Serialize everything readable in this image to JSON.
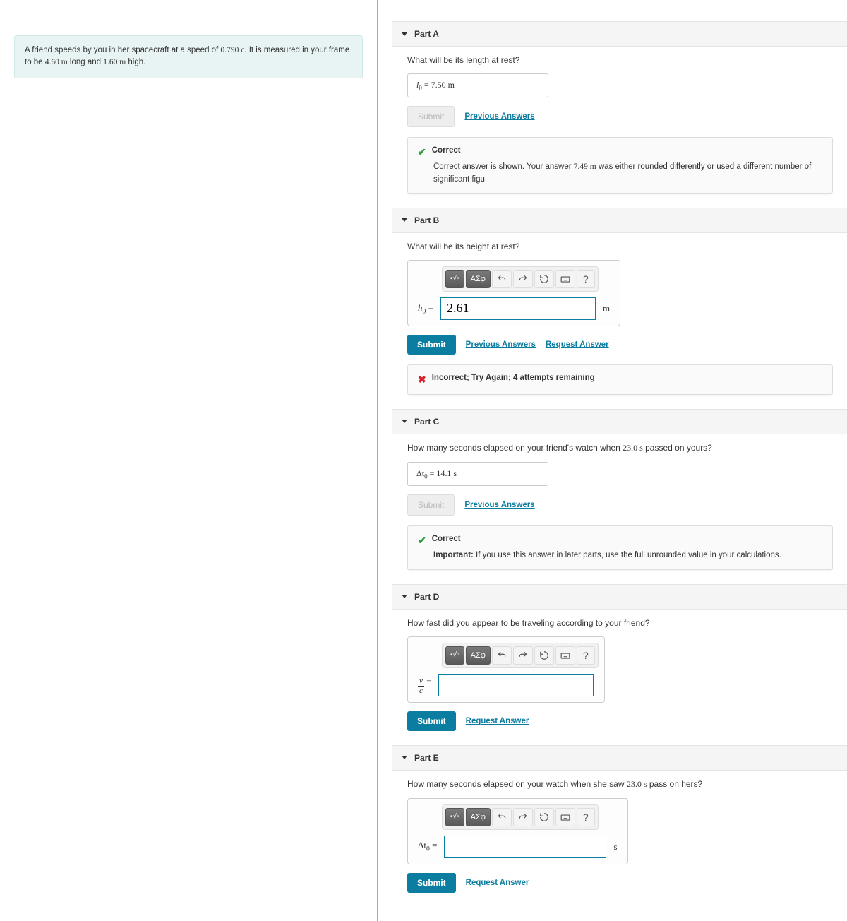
{
  "problem": {
    "text_before_speed": "A friend speeds by you in her spacecraft at a speed of ",
    "speed": "0.790 c",
    "text_mid": ". It is measured in your frame to be ",
    "length": "4.60 m",
    "text_mid2": " long and ",
    "height": "1.60 m",
    "text_after": " high."
  },
  "links": {
    "submit": "Submit",
    "previous_answers": "Previous Answers",
    "request_answer": "Request Answer"
  },
  "partA": {
    "title": "Part A",
    "question": "What will be its length at rest?",
    "var": "l",
    "sub": "0",
    "eq": " = ",
    "value": "7.50 ",
    "unit": "m",
    "fb_title": "Correct",
    "fb_body_pre": "Correct answer is shown. Your answer ",
    "fb_ans": "7.49 m",
    "fb_body_post": " was either rounded differently or used a different number of significant figu"
  },
  "partB": {
    "title": "Part B",
    "question": "What will be its height at rest?",
    "var": "h",
    "sub": "0",
    "eq": " = ",
    "value": "2.61",
    "unit": "m",
    "fb_title": "Incorrect; Try Again; 4 attempts remaining"
  },
  "partC": {
    "title": "Part C",
    "q_pre": "How many seconds elapsed on your friend's watch when ",
    "q_val": "23.0 s",
    "q_post": " passed on yours?",
    "var": "Δt",
    "sub": "0",
    "eq": " = ",
    "value": "14.1 ",
    "unit": "s",
    "fb_title": "Correct",
    "fb_important": "Important:",
    "fb_body": " If you use this answer in later parts, use the full unrounded value in your calculations."
  },
  "partD": {
    "title": "Part D",
    "question": "How fast did you appear to be traveling according to your friend?",
    "var_n": "v",
    "var_d": "c",
    "eq": " = ",
    "value": ""
  },
  "partE": {
    "title": "Part E",
    "q_pre": "How many seconds elapsed on your watch when she saw ",
    "q_val": "23.0 s",
    "q_post": " pass on hers?",
    "var": "Δt",
    "sub": "0",
    "eq": " = ",
    "value": "",
    "unit": "s"
  },
  "toolbar": {
    "templates": "▪√▫",
    "greek": "ΑΣφ",
    "help": "?"
  }
}
